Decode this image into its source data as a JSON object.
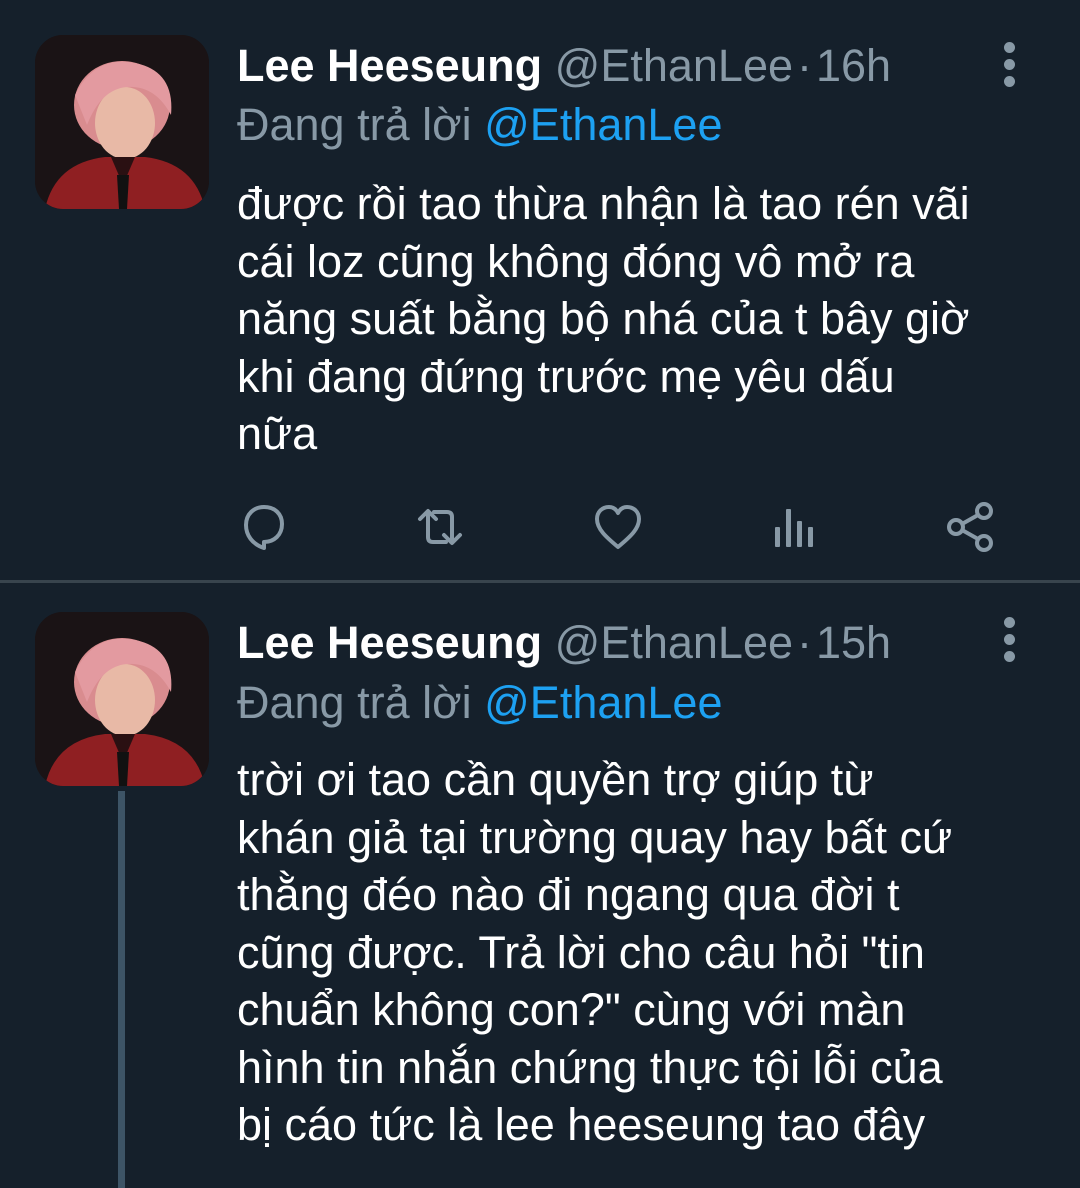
{
  "tweets": [
    {
      "author_name": "Lee Heeseung",
      "author_handle": "@EthanLee",
      "separator": "·",
      "time": "16h",
      "replying_prefix": "Đang trả lời",
      "replying_to": "@EthanLee",
      "text": "được rồi tao thừa nhận là tao rén vãi\ncái loz cũng không đóng vô mở ra\nnăng suất bằng bộ nhá của t bây giờ\nkhi đang đứng trước mẹ yêu dấu\nnữa",
      "actions": [
        "reply-icon",
        "retweet-icon",
        "like-icon",
        "analytics-icon",
        "share-icon"
      ]
    },
    {
      "author_name": "Lee Heeseung",
      "author_handle": "@EthanLee",
      "separator": "·",
      "time": "15h",
      "replying_prefix": "Đang trả lời",
      "replying_to": "@EthanLee",
      "text": "trời ơi tao cần quyền trợ giúp từ\nkhán giả tại trường quay hay bất cứ\nthằng đéo nào đi ngang qua đời t\ncũng được. Trả lời cho câu hỏi \"tin\nchuẩn không con?\" cùng với màn\nhình tin nhắn chứng thực tội lỗi của\nbị cáo tức là lee heeseung tao đây"
    }
  ],
  "colors": {
    "background": "#15202b",
    "secondary_text": "#8899a6",
    "link": "#1da1f2",
    "divider": "#38444d",
    "thread_line": "#3d5466"
  }
}
